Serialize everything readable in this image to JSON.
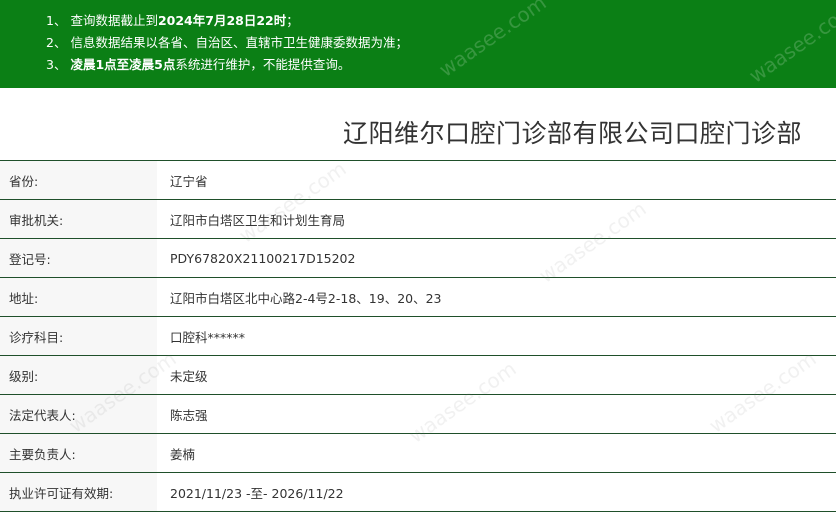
{
  "notice": {
    "lines": [
      {
        "num": "1、",
        "parts": [
          {
            "text": "查询数据截止到",
            "bold": false
          },
          {
            "text": "2024年7月28日22时",
            "bold": true
          },
          {
            "text": "；",
            "bold": false
          }
        ]
      },
      {
        "num": "2、",
        "parts": [
          {
            "text": "信息数据结果以各省、自治区、直辖市卫生健康委数据为准；",
            "bold": false
          }
        ]
      },
      {
        "num": "3、",
        "parts": [
          {
            "text": "凌晨1点至凌晨5点",
            "bold": true
          },
          {
            "text": "系统进行维护，不能提供查询。",
            "bold": false
          }
        ]
      }
    ]
  },
  "title": "辽阳维尔口腔门诊部有限公司口腔门诊部",
  "rows": [
    {
      "label": "省份:",
      "value": "辽宁省"
    },
    {
      "label": "审批机关:",
      "value": "辽阳市白塔区卫生和计划生育局"
    },
    {
      "label": "登记号:",
      "value": "PDY67820X21100217D15202"
    },
    {
      "label": "地址:",
      "value": "辽阳市白塔区北中心路2-4号2-18、19、20、23"
    },
    {
      "label": "诊疗科目:",
      "value": "口腔科******"
    },
    {
      "label": "级别:",
      "value": "未定级"
    },
    {
      "label": "法定代表人:",
      "value": "陈志强"
    },
    {
      "label": "主要负责人:",
      "value": "姜楠"
    },
    {
      "label": "执业许可证有效期:",
      "value": "2021/11/23 -至- 2026/11/22"
    }
  ],
  "watermark": "waasee.com"
}
